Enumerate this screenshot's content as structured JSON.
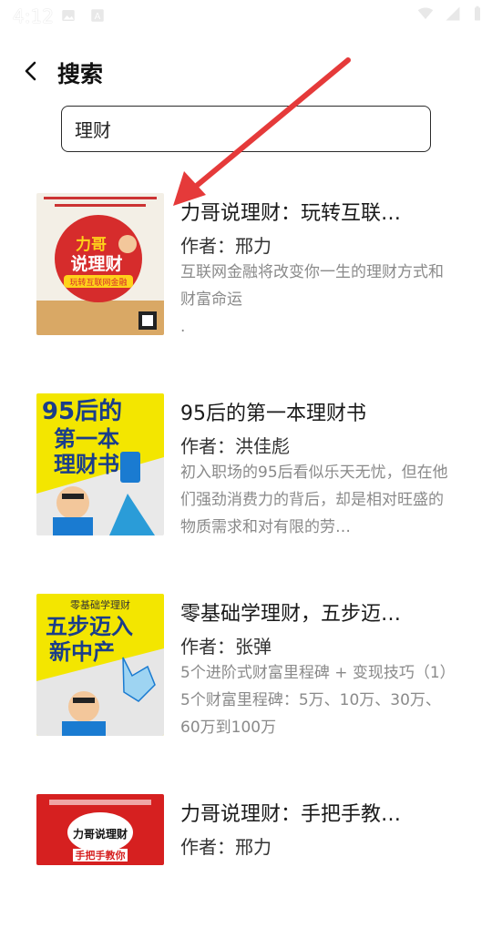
{
  "status_bar": {
    "time": "4:12",
    "left_icons": [
      "image-icon",
      "a-badge-icon"
    ],
    "right_icons": [
      "wifi-icon",
      "cell-signal-icon",
      "battery-icon"
    ]
  },
  "header": {
    "title": "搜索",
    "back_icon": "back-arrow-icon"
  },
  "search": {
    "value": "理财"
  },
  "results": [
    {
      "title": "力哥说理财：玩转互联…",
      "author": "作者：邢力",
      "description": "互联网金融将改变你一生的理财方式和财富命运\n.",
      "cover": {
        "bg": "#f3efe6",
        "main": "#d62c2c",
        "text": "力哥说理财",
        "sub": "玩转互联网金融"
      }
    },
    {
      "title": "95后的第一本理财书",
      "author": "作者：洪佳彪",
      "description": "初入职场的95后看似乐天无忧，但在他们强劲消费力的背后，却是相对旺盛的物质需求和对有限的劳…",
      "cover": {
        "bg": "#e9e9e9",
        "main": "#f3e600",
        "text": "95后的第一本理财书"
      }
    },
    {
      "title": "零基础学理财，五步迈…",
      "author": "作者：张弹",
      "description": "5个进阶式财富里程碑 + 变现技巧（1）5个财富里程碑：5万、10万、30万、60万到100万",
      "cover": {
        "bg": "#f3e600",
        "main": "#1a7bd1",
        "text": "五步迈入新中产"
      }
    },
    {
      "title": "力哥说理财：手把手教…",
      "author": "作者：邢力",
      "description": "",
      "cover": {
        "bg": "#ffffff",
        "main": "#d62020",
        "text": "力哥说理财 手把手教你"
      }
    }
  ],
  "annotation": {
    "color": "#e53a3a"
  }
}
